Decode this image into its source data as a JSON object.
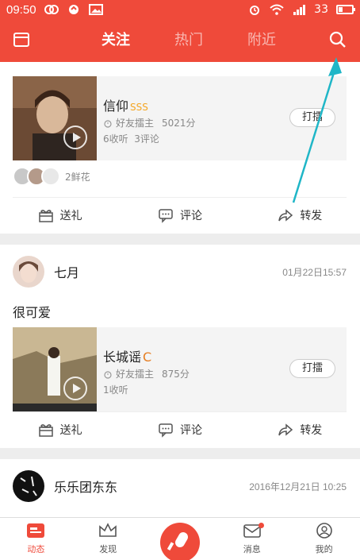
{
  "status_bar": {
    "time": "09:50",
    "network": "3G",
    "battery": "33",
    "battery_level": 0.33
  },
  "top_nav": {
    "tabs": [
      {
        "label": "关注",
        "active": true
      },
      {
        "label": "热门",
        "active": false
      },
      {
        "label": "附近",
        "active": false
      }
    ],
    "left_icon": "folder-icon",
    "right_icon": "search-icon"
  },
  "feed": [
    {
      "song": {
        "title": "信仰",
        "grade": "SSS",
        "host_label": "好友擂主",
        "score": "5021分",
        "listens": "6收听",
        "comments": "3评论",
        "play_label": "打擂"
      },
      "flowers_label": "2鲜花",
      "actions": {
        "gift": "送礼",
        "comment": "评论",
        "share": "转发"
      }
    },
    {
      "user": {
        "name": "七月",
        "time": "01月22日15:57"
      },
      "text": "很可爱",
      "song": {
        "title": "长城谣",
        "grade": "C",
        "host_label": "好友擂主",
        "score": "875分",
        "listens": "1收听",
        "play_label": "打擂"
      },
      "actions": {
        "gift": "送礼",
        "comment": "评论",
        "share": "转发"
      }
    },
    {
      "user": {
        "name": "乐乐团东东",
        "time": "2016年12月21日 10:25"
      }
    }
  ],
  "bottom_nav": [
    {
      "label": "动态",
      "icon": "feed-icon",
      "active": true
    },
    {
      "label": "发现",
      "icon": "crown-icon",
      "active": false
    },
    {
      "label": "",
      "icon": "microphone-icon",
      "active": false
    },
    {
      "label": "消息",
      "icon": "message-icon",
      "active": false
    },
    {
      "label": "我的",
      "icon": "profile-icon",
      "active": false
    }
  ],
  "colors": {
    "brand": "#ef4a3a",
    "annotation": "#1fb6c7"
  }
}
